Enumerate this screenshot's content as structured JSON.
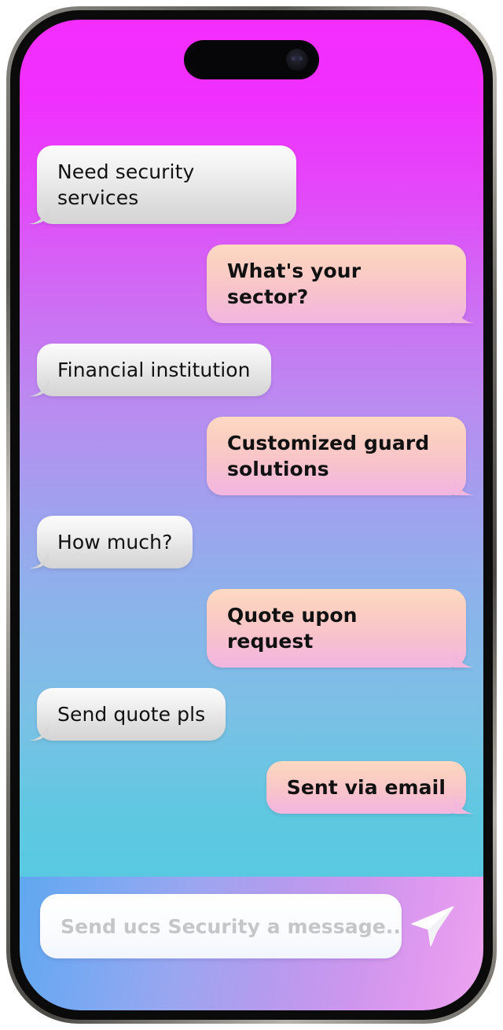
{
  "device": {
    "type": "smartphone-mockup",
    "frame_color": "#6e6c67",
    "island_label": "dynamic-island",
    "camera_label": "front-camera"
  },
  "theme": {
    "background_top": "#f42dff",
    "background_mid": "#9fa2ee",
    "background_bottom": "#58c9e2",
    "composer_left": "#5fa8f0",
    "composer_right": "#eda4ef",
    "incoming_bubble": "#eeeeee",
    "outgoing_bubble_top": "#fcd9c3",
    "outgoing_bubble_bottom": "#f2b6e0",
    "text_color": "#111111",
    "placeholder_color": "#c6c6c8"
  },
  "conversation": {
    "messages": [
      {
        "side": "in",
        "text": "Need security services"
      },
      {
        "side": "out",
        "text": "What's your sector?"
      },
      {
        "side": "in",
        "text": "Financial institution"
      },
      {
        "side": "out",
        "text": "Customized guard solutions"
      },
      {
        "side": "in",
        "text": "How much?"
      },
      {
        "side": "out",
        "text": "Quote upon request"
      },
      {
        "side": "in",
        "text": "Send quote pls"
      },
      {
        "side": "out",
        "text": "Sent via email"
      }
    ]
  },
  "composer": {
    "placeholder": "Send ucs Security a message....",
    "value": "",
    "send_icon": "paper-plane-icon"
  }
}
